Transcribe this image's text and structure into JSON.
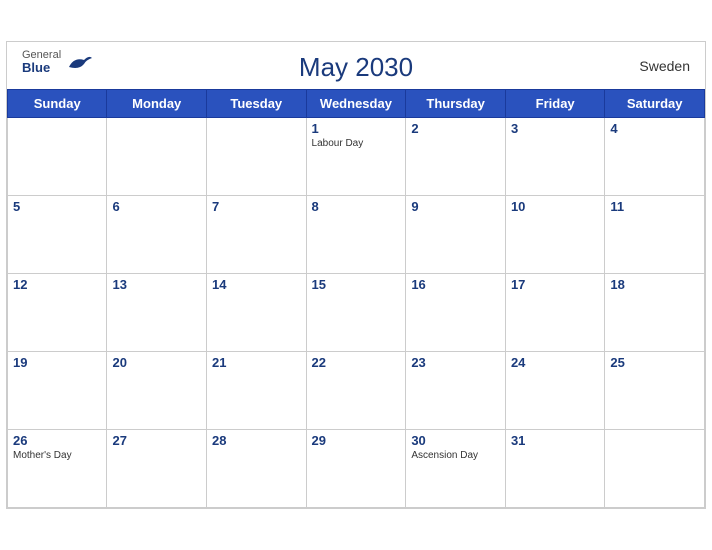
{
  "header": {
    "title": "May 2030",
    "country": "Sweden",
    "logo": {
      "general": "General",
      "blue": "Blue"
    }
  },
  "weekdays": [
    "Sunday",
    "Monday",
    "Tuesday",
    "Wednesday",
    "Thursday",
    "Friday",
    "Saturday"
  ],
  "weeks": [
    [
      {
        "day": "",
        "holiday": ""
      },
      {
        "day": "",
        "holiday": ""
      },
      {
        "day": "",
        "holiday": ""
      },
      {
        "day": "1",
        "holiday": "Labour Day"
      },
      {
        "day": "2",
        "holiday": ""
      },
      {
        "day": "3",
        "holiday": ""
      },
      {
        "day": "4",
        "holiday": ""
      }
    ],
    [
      {
        "day": "5",
        "holiday": ""
      },
      {
        "day": "6",
        "holiday": ""
      },
      {
        "day": "7",
        "holiday": ""
      },
      {
        "day": "8",
        "holiday": ""
      },
      {
        "day": "9",
        "holiday": ""
      },
      {
        "day": "10",
        "holiday": ""
      },
      {
        "day": "11",
        "holiday": ""
      }
    ],
    [
      {
        "day": "12",
        "holiday": ""
      },
      {
        "day": "13",
        "holiday": ""
      },
      {
        "day": "14",
        "holiday": ""
      },
      {
        "day": "15",
        "holiday": ""
      },
      {
        "day": "16",
        "holiday": ""
      },
      {
        "day": "17",
        "holiday": ""
      },
      {
        "day": "18",
        "holiday": ""
      }
    ],
    [
      {
        "day": "19",
        "holiday": ""
      },
      {
        "day": "20",
        "holiday": ""
      },
      {
        "day": "21",
        "holiday": ""
      },
      {
        "day": "22",
        "holiday": ""
      },
      {
        "day": "23",
        "holiday": ""
      },
      {
        "day": "24",
        "holiday": ""
      },
      {
        "day": "25",
        "holiday": ""
      }
    ],
    [
      {
        "day": "26",
        "holiday": "Mother's Day"
      },
      {
        "day": "27",
        "holiday": ""
      },
      {
        "day": "28",
        "holiday": ""
      },
      {
        "day": "29",
        "holiday": ""
      },
      {
        "day": "30",
        "holiday": "Ascension Day"
      },
      {
        "day": "31",
        "holiday": ""
      },
      {
        "day": "",
        "holiday": ""
      }
    ]
  ],
  "colors": {
    "header_bg": "#2a52be",
    "day_number_color": "#1a3a7c",
    "title_color": "#1a3a7c"
  }
}
